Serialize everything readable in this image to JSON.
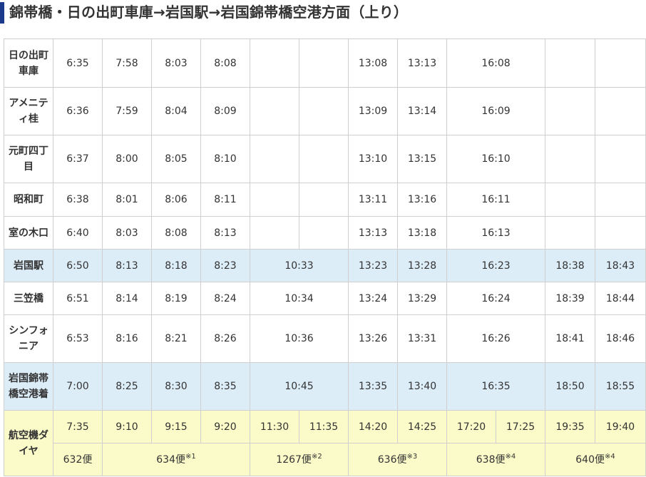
{
  "title": "錦帯橋・日の出町車庫→岩国駅→岩国錦帯橋空港方面（上り）",
  "stops": [
    {
      "name": "日の出町車庫",
      "times": [
        "6:35",
        "7:58",
        "8:03",
        "8:08",
        "",
        "",
        "13:08",
        "13:13",
        "16:08",
        "",
        ""
      ]
    },
    {
      "name": "アメニティ桂",
      "times": [
        "6:36",
        "7:59",
        "8:04",
        "8:09",
        "",
        "",
        "13:09",
        "13:14",
        "16:09",
        "",
        ""
      ]
    },
    {
      "name": "元町四丁目",
      "times": [
        "6:37",
        "8:00",
        "8:05",
        "8:10",
        "",
        "",
        "13:10",
        "13:15",
        "16:10",
        "",
        ""
      ]
    },
    {
      "name": "昭和町",
      "times": [
        "6:38",
        "8:01",
        "8:06",
        "8:11",
        "",
        "",
        "13:11",
        "13:16",
        "16:11",
        "",
        ""
      ]
    },
    {
      "name": "室の木口",
      "times": [
        "6:40",
        "8:03",
        "8:08",
        "8:13",
        "",
        "",
        "13:13",
        "13:18",
        "16:13",
        "",
        ""
      ]
    },
    {
      "name": "岩国駅",
      "times": [
        "6:50",
        "8:13",
        "8:18",
        "8:23",
        "10:33",
        "13:23",
        "13:28",
        "16:23",
        "18:38",
        "18:43"
      ]
    },
    {
      "name": "三笠橋",
      "times": [
        "6:51",
        "8:14",
        "8:19",
        "8:24",
        "10:34",
        "13:24",
        "13:29",
        "16:24",
        "18:39",
        "18:44"
      ]
    },
    {
      "name": "シンフォニア",
      "times": [
        "6:53",
        "8:16",
        "8:21",
        "8:26",
        "10:36",
        "13:26",
        "13:31",
        "16:26",
        "18:41",
        "18:46"
      ]
    },
    {
      "name": "岩国錦帯橋空港着",
      "times": [
        "7:00",
        "8:25",
        "8:30",
        "8:35",
        "10:45",
        "13:35",
        "13:40",
        "16:35",
        "18:50",
        "18:55"
      ]
    }
  ],
  "flight": {
    "label": "航空機ダイヤ",
    "times": [
      "7:35",
      "9:10",
      "9:15",
      "9:20",
      "11:30",
      "11:35",
      "14:20",
      "14:25",
      "17:20",
      "17:25",
      "19:35",
      "19:40"
    ],
    "numbers": [
      {
        "text": "632便",
        "note": ""
      },
      {
        "text": "634便",
        "note": "※1"
      },
      {
        "text": "1267便",
        "note": "※2"
      },
      {
        "text": "636便",
        "note": "※3"
      },
      {
        "text": "638便",
        "note": "※4"
      },
      {
        "text": "640便",
        "note": "※4"
      }
    ]
  }
}
